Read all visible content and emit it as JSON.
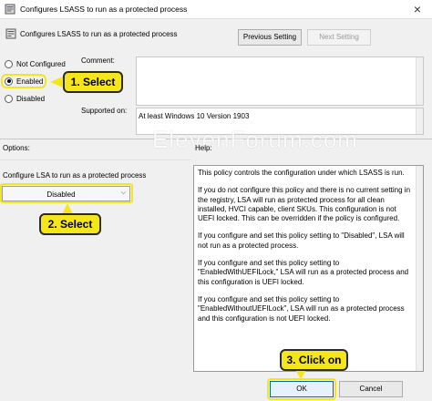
{
  "window": {
    "title": "Configures LSASS to run as a protected process",
    "close_glyph": "×"
  },
  "policy": {
    "name": "Configures LSASS to run as a protected process",
    "prev_button": "Previous Setting",
    "next_button": "Next Setting"
  },
  "state": {
    "options": [
      {
        "label": "Not Configured",
        "checked": false
      },
      {
        "label": "Enabled",
        "checked": true
      },
      {
        "label": "Disabled",
        "checked": false
      }
    ],
    "comment_label": "Comment:",
    "comment_value": "",
    "supported_label": "Supported on:",
    "supported_value": "At least Windows 10 Version 1903"
  },
  "watermark": "ElevenForum.com",
  "options_panel": {
    "label": "Options:",
    "caption": "Configure LSA to run as a protected process",
    "dropdown_value": "Disabled"
  },
  "help_panel": {
    "label": "Help:",
    "paragraphs": [
      "This policy controls the configuration under which LSASS is run.",
      "If you do not configure this policy and there is no current setting in the registry, LSA will run as protected process for all clean installed, HVCI capable, client SKUs. This configuration is not UEFI locked. This can be overridden if the policy is configured.",
      "If you configure and set this policy setting to \"Disabled\", LSA will not run as a protected process.",
      "If you configure and set this policy setting to \"EnabledWithUEFILock,\" LSA will run as a protected process and this configuration is UEFI locked.",
      "If you configure and set this policy setting to \"EnabledWithoutUEFILock\", LSA will run as a protected process and this configuration is not UEFI locked."
    ]
  },
  "footer": {
    "ok": "OK",
    "cancel": "Cancel"
  },
  "callouts": {
    "step1": "1. Select",
    "step2": "2. Select",
    "step3": "3. Click on"
  },
  "colors": {
    "callout": "#f5e61c",
    "accent": "#0067c0"
  },
  "icons": {
    "app": "policy-app-icon",
    "policy": "policy-setting-icon",
    "dropdown": "chevron-down-icon",
    "close": "close-icon"
  }
}
